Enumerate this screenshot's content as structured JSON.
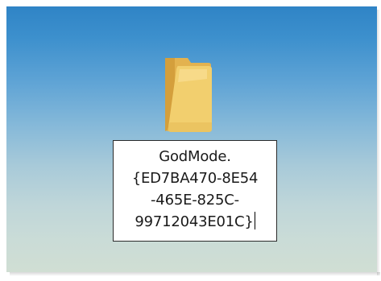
{
  "desktop": {
    "background_colors": [
      "#2f84c6",
      "#86b9d9",
      "#d0ded3"
    ],
    "folder": {
      "icon": "folder-icon",
      "icon_colors": {
        "front": "#f2cf6e",
        "back": "#e3b24f",
        "highlight": "#fbe3a0"
      },
      "rename_input": {
        "value_lines": [
          "GodMode.",
          "{ED7BA470-8E54",
          "-465E-825C-",
          "99712043E01C}"
        ]
      }
    }
  }
}
